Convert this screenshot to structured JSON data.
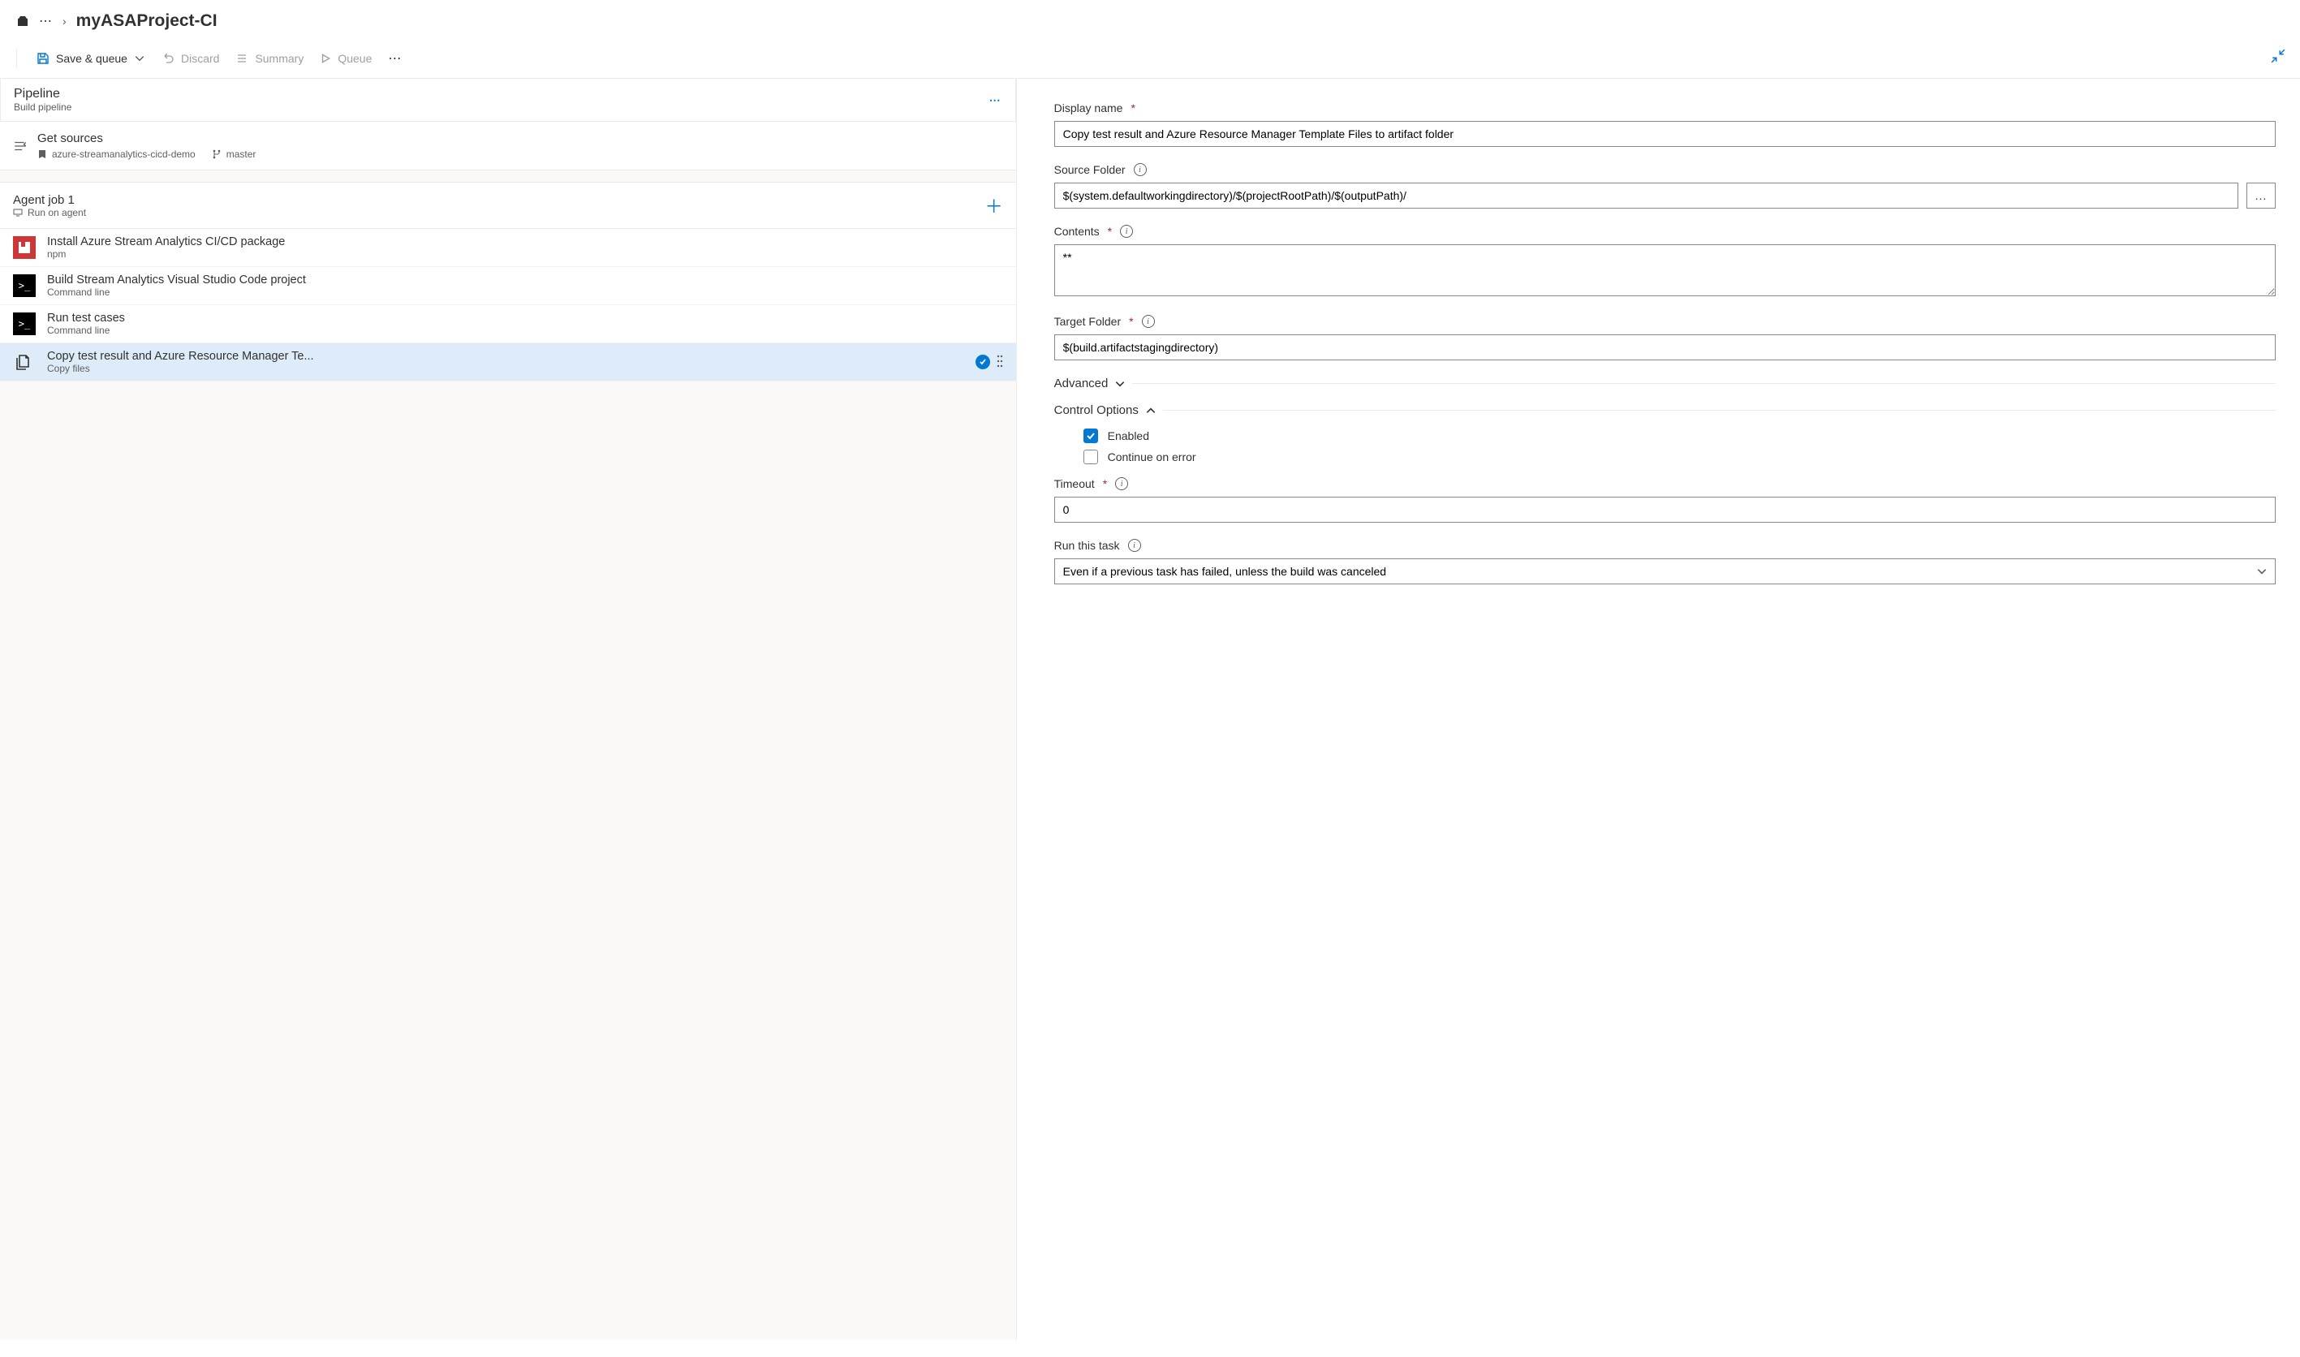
{
  "breadcrumb": {
    "title": "myASAProject-CI"
  },
  "toolbar": {
    "save_queue": "Save & queue",
    "discard": "Discard",
    "summary": "Summary",
    "queue": "Queue"
  },
  "pipeline": {
    "title": "Pipeline",
    "subtitle": "Build pipeline"
  },
  "sources": {
    "title": "Get sources",
    "repo": "azure-streamanalytics-cicd-demo",
    "branch": "master"
  },
  "agent_job": {
    "title": "Agent job 1",
    "subtitle": "Run on agent"
  },
  "tasks": [
    {
      "title": "Install Azure Stream Analytics CI/CD package",
      "sub": "npm",
      "icon": "npm"
    },
    {
      "title": "Build Stream Analytics Visual Studio Code project",
      "sub": "Command line",
      "icon": "cmd"
    },
    {
      "title": "Run test cases",
      "sub": "Command line",
      "icon": "cmd"
    },
    {
      "title": "Copy test result and Azure Resource Manager Te...",
      "sub": "Copy files",
      "icon": "copy",
      "selected": true
    }
  ],
  "form": {
    "display_name_label": "Display name",
    "display_name": "Copy test result and Azure Resource Manager Template Files to artifact folder",
    "source_folder_label": "Source Folder",
    "source_folder": "$(system.defaultworkingdirectory)/$(projectRootPath)/$(outputPath)/",
    "contents_label": "Contents",
    "contents": "**",
    "target_folder_label": "Target Folder",
    "target_folder": "$(build.artifactstagingdirectory)",
    "advanced_label": "Advanced",
    "control_options_label": "Control Options",
    "enabled_label": "Enabled",
    "continue_label": "Continue on error",
    "enabled_checked": true,
    "continue_checked": false,
    "timeout_label": "Timeout",
    "timeout": "0",
    "run_task_label": "Run this task",
    "run_task_value": "Even if a previous task has failed, unless the build was canceled"
  }
}
